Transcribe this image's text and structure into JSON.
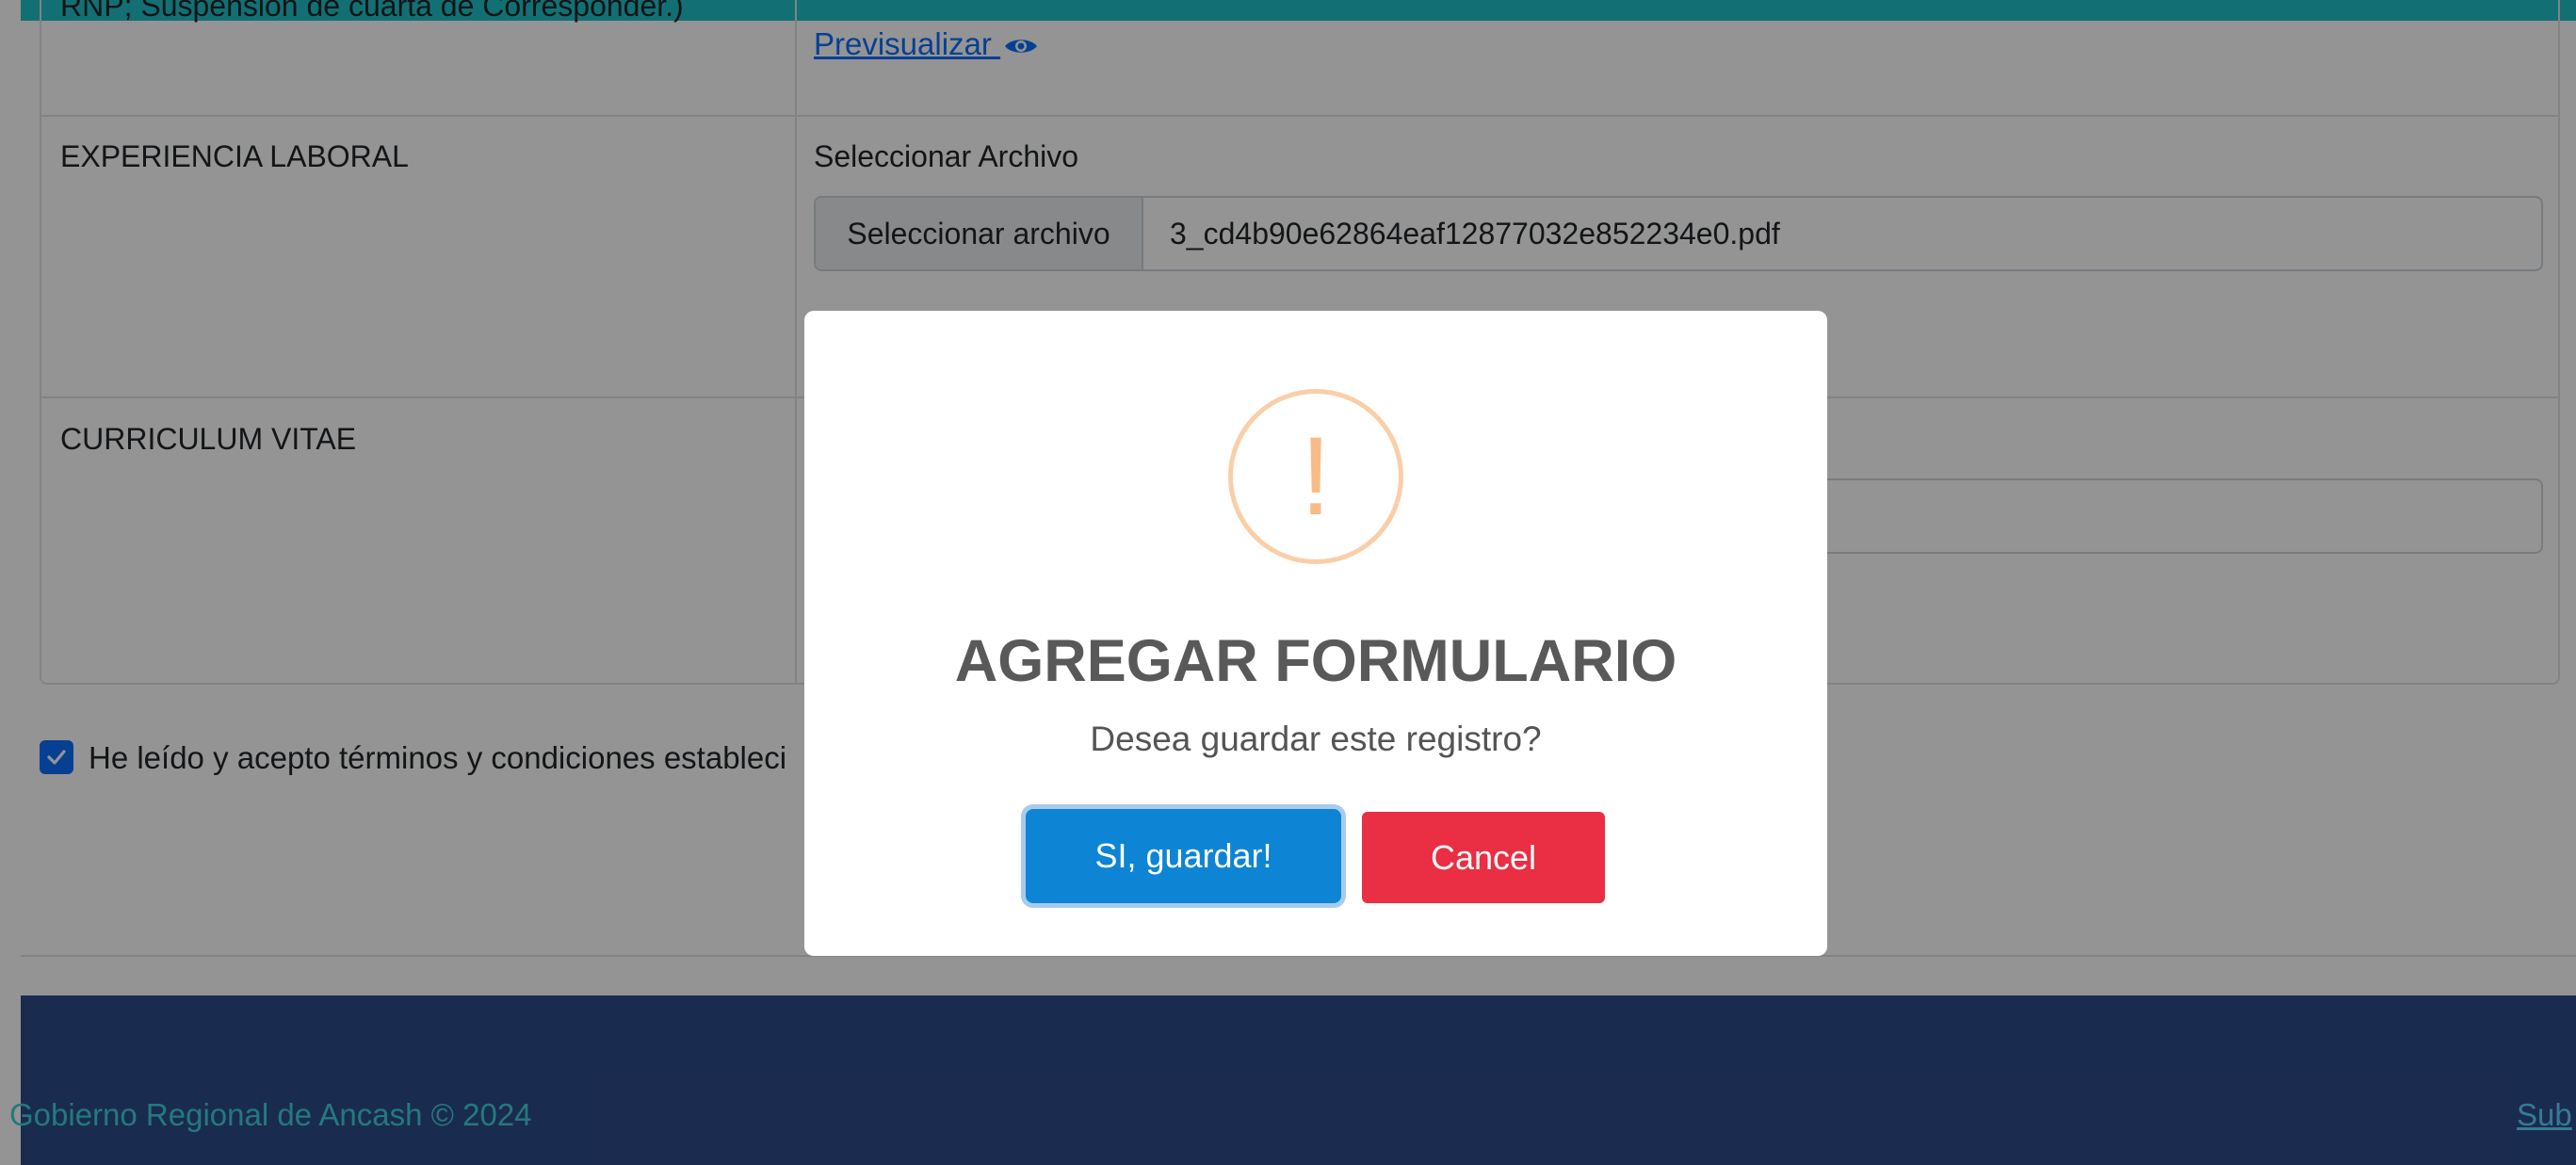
{
  "page": {
    "partial_row_label": "RNP; Suspensión de cuarta de Corresponder.)",
    "preview_link": "Previsualizar ",
    "rows": [
      {
        "label": "EXPERIENCIA LABORAL",
        "caption": "Seleccionar Archivo",
        "button": "Seleccionar archivo",
        "file_name": "3_cd4b90e62864eaf12877032e852234e0.pdf"
      },
      {
        "label": "CURRICULUM VITAE"
      }
    ],
    "terms_text": "He leído y acepto términos y condiciones estableci",
    "terms_checked": true,
    "footer_text": "Gobierno Regional de Ancash © 2024",
    "footer_link": "Sub"
  },
  "modal": {
    "icon": "warning-icon",
    "icon_glyph": "!",
    "title": "AGREGAR FORMULARIO",
    "text": "Desea guardar este registro?",
    "confirm_label": "SI, guardar!",
    "cancel_label": "Cancel"
  },
  "colors": {
    "accent_bar": "#20c1c9",
    "footer_bg": "#2e4a8a",
    "confirm": "#0d84d4",
    "cancel": "#ea2e43",
    "warning": "#f8bb86"
  }
}
